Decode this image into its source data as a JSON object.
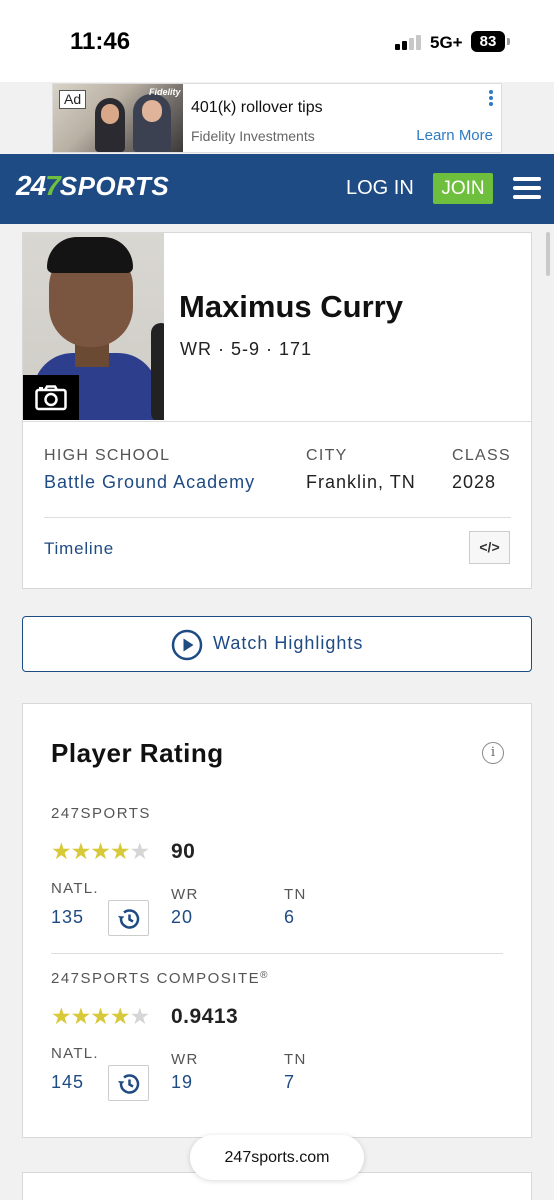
{
  "status_bar": {
    "time": "11:46",
    "network": "5G+",
    "battery": "83"
  },
  "ad": {
    "tag": "Ad",
    "brand": "Fidelity",
    "title": "401(k) rollover tips",
    "advertiser": "Fidelity Investments",
    "cta": "Learn More"
  },
  "header": {
    "logo_num_a": "24",
    "logo_num_b": "7",
    "logo_word": "SPORTS",
    "login": "LOG IN",
    "join": "JOIN",
    "icons": {
      "menu": "hamburger-icon"
    }
  },
  "player": {
    "name": "Maximus Curry",
    "meta": "WR · 5-9 · 171",
    "high_school_label": "HIGH SCHOOL",
    "high_school": "Battle Ground Academy",
    "city_label": "CITY",
    "city": "Franklin, TN",
    "class_label": "CLASS",
    "class": "2028",
    "timeline": "Timeline",
    "embed": "</>"
  },
  "watch": {
    "label": "Watch Highlights"
  },
  "rating": {
    "title": "Player Rating",
    "info": "i",
    "sources": [
      {
        "name": "247SPORTS",
        "stars": 4,
        "score": "90",
        "natl_label": "NATL.",
        "natl": "135",
        "pos_label": "WR",
        "pos": "20",
        "state_label": "TN",
        "state": "6"
      },
      {
        "name": "247SPORTS COMPOSITE",
        "reg": "®",
        "stars": 4,
        "score": "0.9413",
        "natl_label": "NATL.",
        "natl": "145",
        "pos_label": "WR",
        "pos": "19",
        "state_label": "TN",
        "state": "7"
      }
    ]
  },
  "browser": {
    "url": "247sports.com"
  },
  "colors": {
    "brand_blue": "#1e4b83",
    "join_green": "#6fbf3f",
    "star_gold": "#d8c93a"
  }
}
